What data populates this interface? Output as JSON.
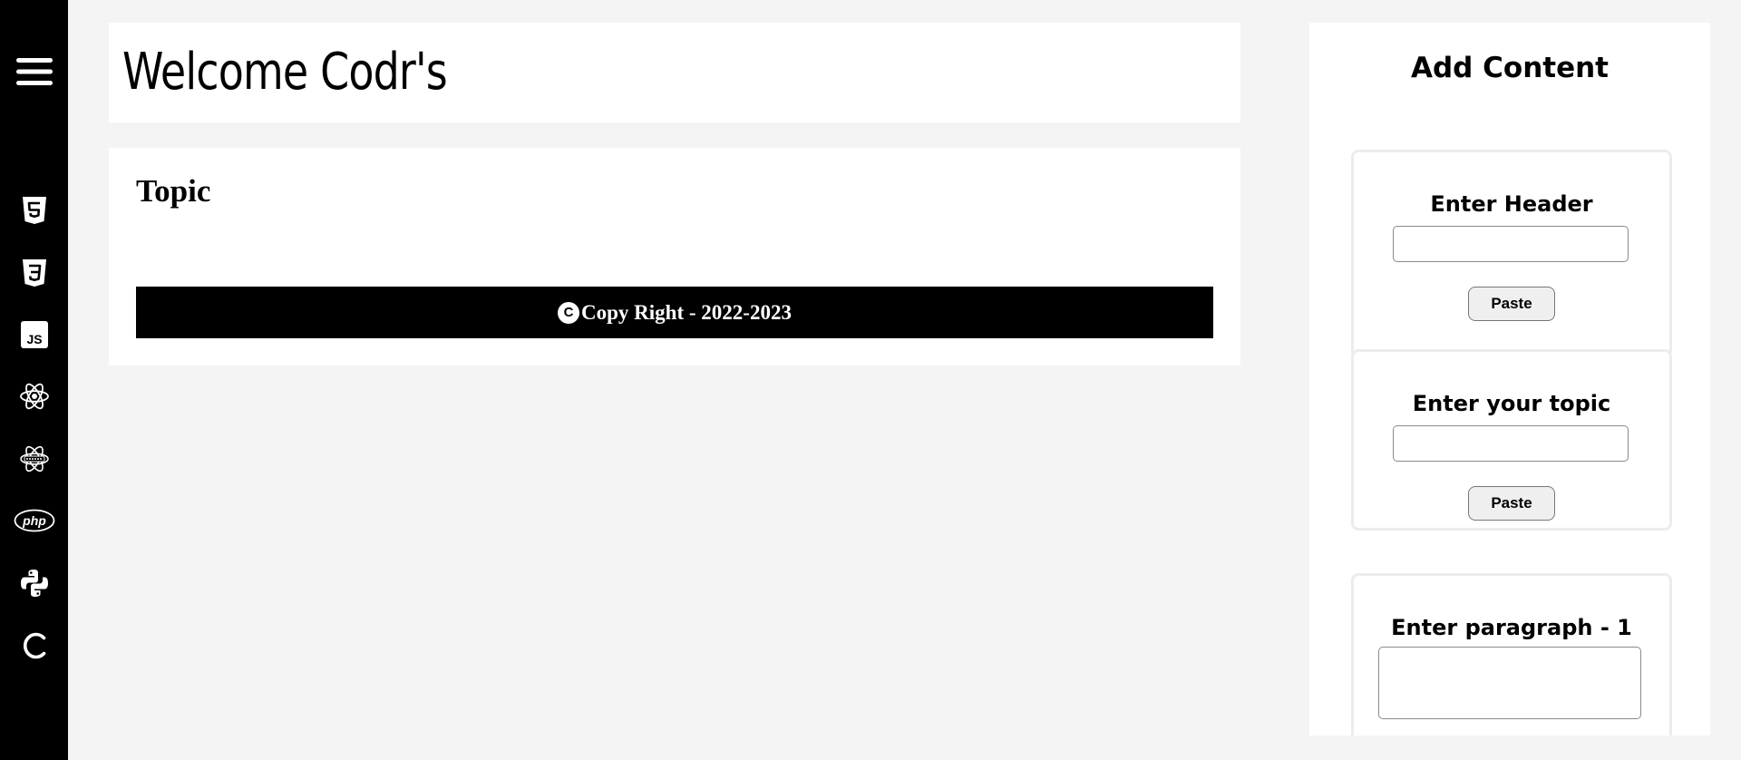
{
  "sidebar": {
    "items": [
      {
        "icon": "menu-icon"
      },
      {
        "icon": "html5-icon"
      },
      {
        "icon": "css3-icon"
      },
      {
        "icon": "js-icon",
        "label": "JS"
      },
      {
        "icon": "react-icon"
      },
      {
        "icon": "react-native-icon"
      },
      {
        "icon": "php-icon",
        "label": "php"
      },
      {
        "icon": "python-icon"
      },
      {
        "icon": "c-language-icon"
      }
    ]
  },
  "header": {
    "title": "Welcome Codr's"
  },
  "main": {
    "topic": "Topic",
    "footer": {
      "copyright_symbol": "C",
      "text": "Copy Right - 2022-2023"
    }
  },
  "panel": {
    "title": "Add Content",
    "forms": [
      {
        "label": "Enter Header",
        "input_value": "",
        "button": "Paste"
      },
      {
        "label": "Enter your topic",
        "input_value": "",
        "button": "Paste"
      },
      {
        "label": "Enter paragraph - 1",
        "textarea_value": ""
      }
    ]
  },
  "colors": {
    "sidebar_bg": "#000000",
    "page_bg": "#f4f4f4",
    "card_bg": "#ffffff",
    "footer_bg": "#000000",
    "box_border": "#ececec"
  }
}
